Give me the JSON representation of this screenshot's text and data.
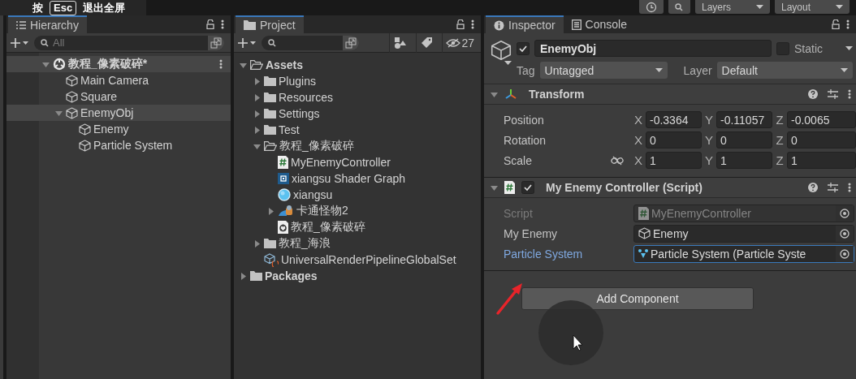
{
  "fullscreen_hint": {
    "prefix": "按",
    "key": "Esc",
    "suffix": "退出全屏"
  },
  "top_bar": {
    "dropdowns": [
      "Layers",
      "Layout"
    ]
  },
  "hierarchy": {
    "tab": "Hierarchy",
    "search": {
      "placeholder": "All"
    },
    "tree": [
      {
        "label": "教程_像素破碎*",
        "kind": "scene",
        "expanded": true,
        "children": [
          {
            "label": "Main Camera",
            "kind": "object",
            "selected": false
          },
          {
            "label": "Square",
            "kind": "object",
            "selected": false
          },
          {
            "label": "EnemyObj",
            "kind": "object",
            "expanded": true,
            "selected": true,
            "children": [
              {
                "label": "Enemy",
                "kind": "object",
                "selected": false
              },
              {
                "label": "Particle System",
                "kind": "object",
                "selected": false
              }
            ]
          }
        ]
      }
    ]
  },
  "project": {
    "tab": "Project",
    "hidden_count": "27",
    "tree": [
      {
        "label": "Assets",
        "kind": "folder",
        "expanded": true,
        "children": [
          {
            "label": "Plugins",
            "kind": "folder",
            "expanded": false
          },
          {
            "label": "Resources",
            "kind": "folder",
            "expanded": false
          },
          {
            "label": "Settings",
            "kind": "folder",
            "expanded": false
          },
          {
            "label": "Test",
            "kind": "folder",
            "expanded": false
          },
          {
            "label": "教程_像素破碎",
            "kind": "folder",
            "expanded": true,
            "children": [
              {
                "label": "MyEnemyController",
                "kind": "script"
              },
              {
                "label": "xiangsu Shader Graph",
                "kind": "shadergraph"
              },
              {
                "label": "xiangsu",
                "kind": "material"
              },
              {
                "label": "卡通怪物2",
                "kind": "model",
                "expanded": false
              },
              {
                "label": "教程_像素破碎",
                "kind": "scenefile"
              }
            ]
          },
          {
            "label": "教程_海浪",
            "kind": "folder",
            "expanded": false
          },
          {
            "label": "UniversalRenderPipelineGlobalSet",
            "kind": "asset"
          }
        ]
      },
      {
        "label": "Packages",
        "kind": "folder",
        "expanded": false
      }
    ]
  },
  "inspector": {
    "tabs": [
      {
        "label": "Inspector",
        "kind": "info",
        "selected": true
      },
      {
        "label": "Console",
        "kind": "console",
        "selected": false
      }
    ],
    "object": {
      "active": true,
      "name": "EnemyObj",
      "static": false,
      "static_label": "Static",
      "tag_label": "Tag",
      "tag": "Untagged",
      "layer_label": "Layer",
      "layer": "Default"
    },
    "components": [
      {
        "title": "Transform",
        "kind": "transform",
        "expanded": true,
        "rows": [
          {
            "label": "Position",
            "values": [
              {
                "axis": "X",
                "value": "-0.3364"
              },
              {
                "axis": "Y",
                "value": "-0.11057"
              },
              {
                "axis": "Z",
                "value": "-0.0065"
              }
            ]
          },
          {
            "label": "Rotation",
            "values": [
              {
                "axis": "X",
                "value": "0"
              },
              {
                "axis": "Y",
                "value": "0"
              },
              {
                "axis": "Z",
                "value": "0"
              }
            ]
          },
          {
            "label": "Scale",
            "linked": false,
            "values": [
              {
                "axis": "X",
                "value": "1"
              },
              {
                "axis": "Y",
                "value": "1"
              },
              {
                "axis": "Z",
                "value": "1"
              }
            ]
          }
        ]
      },
      {
        "title": "My Enemy Controller (Script)",
        "kind": "script",
        "enabled": true,
        "expanded": true,
        "fields": [
          {
            "label": "Script",
            "kind": "script",
            "value": "MyEnemyController",
            "disabled": true,
            "focused": false
          },
          {
            "label": "My Enemy",
            "kind": "gameobject",
            "value": "Enemy",
            "disabled": false,
            "focused": false
          },
          {
            "label": "Particle System",
            "kind": "particle",
            "value": "Particle System (Particle Syste",
            "disabled": false,
            "focused": true
          }
        ]
      }
    ],
    "add_button": "Add Component"
  }
}
